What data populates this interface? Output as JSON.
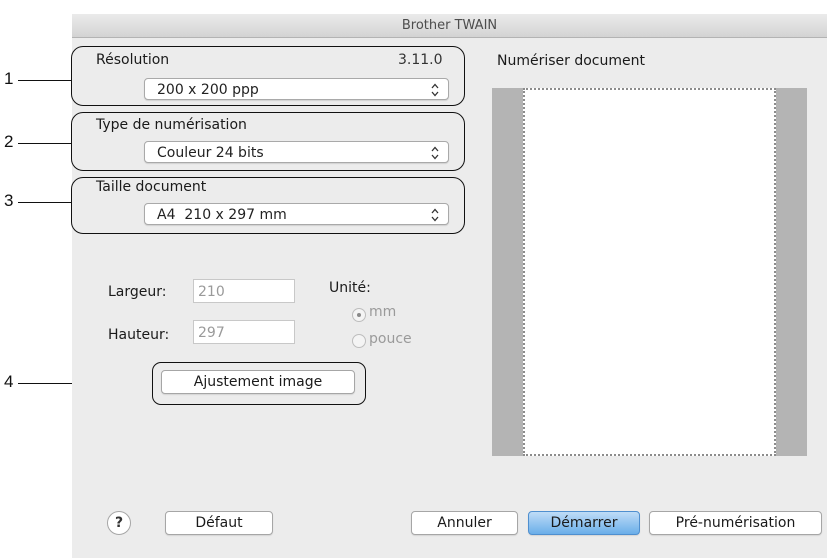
{
  "window": {
    "title": "Brother TWAIN"
  },
  "callouts": [
    "1",
    "2",
    "3",
    "4"
  ],
  "resolution": {
    "label": "Résolution",
    "version": "3.11.0",
    "value": "200 x 200 ppp"
  },
  "scan_type": {
    "label": "Type de numérisation",
    "value": "Couleur 24 bits"
  },
  "doc_size": {
    "label": "Taille document",
    "value": "A4  210 x 297 mm"
  },
  "dimensions": {
    "width_label": "Largeur:",
    "width_value": "210",
    "height_label": "Hauteur:",
    "height_value": "297",
    "unit_label": "Unité:",
    "unit_mm": "mm",
    "unit_inch": "pouce",
    "selected_unit": "mm"
  },
  "adjust_button": "Ajustement image",
  "preview": {
    "label": "Numériser document"
  },
  "footer": {
    "help": "?",
    "default": "Défaut",
    "cancel": "Annuler",
    "start": "Démarrer",
    "prescan": "Pré-numérisation"
  },
  "colors": {
    "primary_button": "#6aaee9",
    "window_bg": "#ececec",
    "preview_border": "#b4b4b4"
  },
  "icons": [
    "updown-arrows-icon",
    "help-icon",
    "radio-selected-icon",
    "radio-unselected-icon"
  ]
}
